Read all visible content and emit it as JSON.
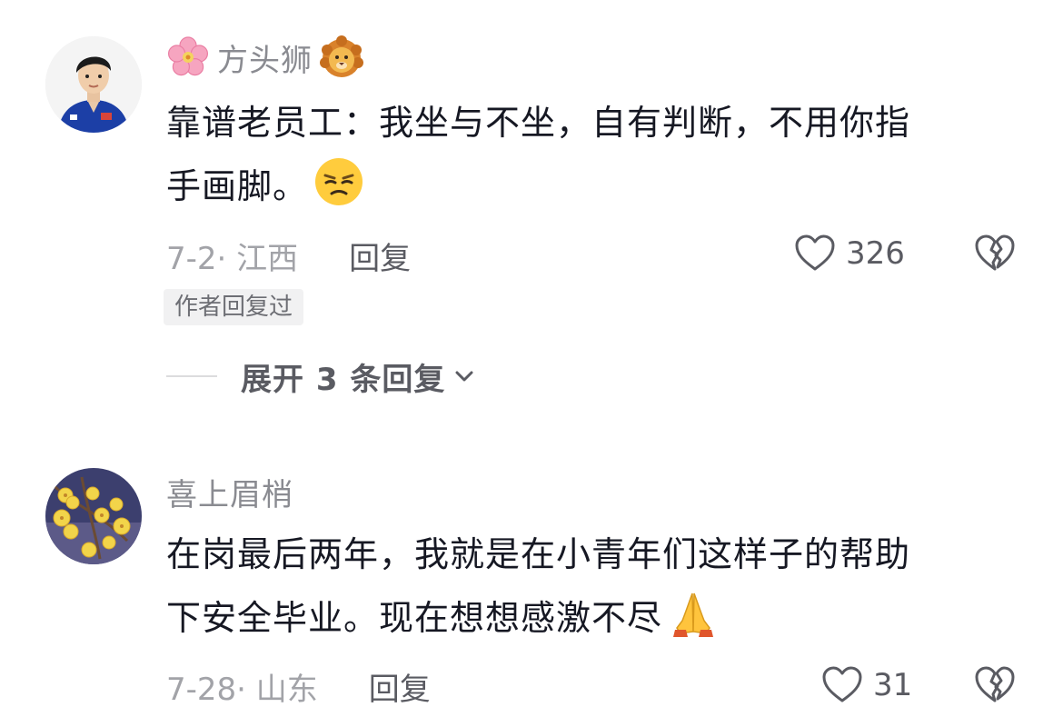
{
  "comments": [
    {
      "username": "方头狮",
      "text_line1": "靠谱老员工：我坐与不坐，自有判断，不用你指",
      "text_line2": "手画脚。",
      "date_location": "7-2· 江西",
      "reply_label": "回复",
      "like_count": "326",
      "author_tag": "作者回复过",
      "expand_replies": "展开 3 条回复"
    },
    {
      "username": "喜上眉梢",
      "text_line1": "在岗最后两年，我就是在小青年们这样子的帮助",
      "text_line2": "下安全毕业。现在想想感激不尽",
      "date_location": "7-28· 山东",
      "reply_label": "回复",
      "like_count": "31"
    }
  ],
  "icons": {
    "badge_prefix": "cherry-blossom-icon",
    "badge_suffix": "lion-face-icon",
    "inline_emoji_1": "unamused-face-icon",
    "inline_emoji_2": "folded-hands-icon",
    "like": "heart-outline-icon",
    "dislike": "broken-heart-outline-icon",
    "expand": "chevron-down-icon"
  },
  "colors": {
    "text_primary": "#161823",
    "text_secondary": "#8a8b91",
    "tag_bg": "#f1f1f2"
  }
}
